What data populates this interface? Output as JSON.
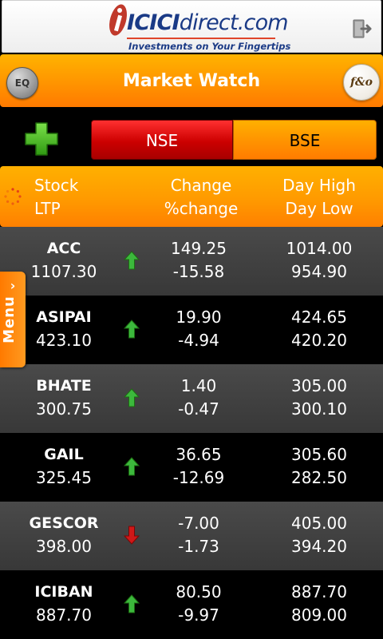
{
  "brand": {
    "icici": "ICICI",
    "direct": "direct.com",
    "tagline": "Investments on Your Fingertips"
  },
  "header": {
    "title": "Market Watch",
    "eq_label": "EQ",
    "fo_label": "f&o"
  },
  "exchange": {
    "options": [
      "NSE",
      "BSE"
    ],
    "selected": "NSE"
  },
  "columns": {
    "col1_line1": "Stock",
    "col1_line2": "LTP",
    "col2_line1": "Change",
    "col2_line2": "%change",
    "col3_line1": "Day High",
    "col3_line2": "Day Low"
  },
  "menu": {
    "label": "Menu"
  },
  "colors": {
    "up": "#3cb83c",
    "down": "#d01818",
    "accent": "#ff9400",
    "selected_tab": "#cc0000"
  },
  "stocks": [
    {
      "name": "ACC",
      "ltp": "1107.30",
      "direction": "up",
      "change": "149.25",
      "pct_change": "-15.58",
      "day_high": "1014.00",
      "day_low": "954.90"
    },
    {
      "name": "ASIPAI",
      "ltp": "423.10",
      "direction": "up",
      "change": "19.90",
      "pct_change": "-4.94",
      "day_high": "424.65",
      "day_low": "420.20"
    },
    {
      "name": "BHATE",
      "ltp": "300.75",
      "direction": "up",
      "change": "1.40",
      "pct_change": "-0.47",
      "day_high": "305.00",
      "day_low": "300.10"
    },
    {
      "name": "GAIL",
      "ltp": "325.45",
      "direction": "up",
      "change": "36.65",
      "pct_change": "-12.69",
      "day_high": "305.60",
      "day_low": "282.50"
    },
    {
      "name": "GESCOR",
      "ltp": "398.00",
      "direction": "down",
      "change": "-7.00",
      "pct_change": "-1.73",
      "day_high": "405.00",
      "day_low": "394.20"
    },
    {
      "name": "ICIBAN",
      "ltp": "887.70",
      "direction": "up",
      "change": "80.50",
      "pct_change": "-9.97",
      "day_high": "887.70",
      "day_low": "809.00"
    }
  ]
}
